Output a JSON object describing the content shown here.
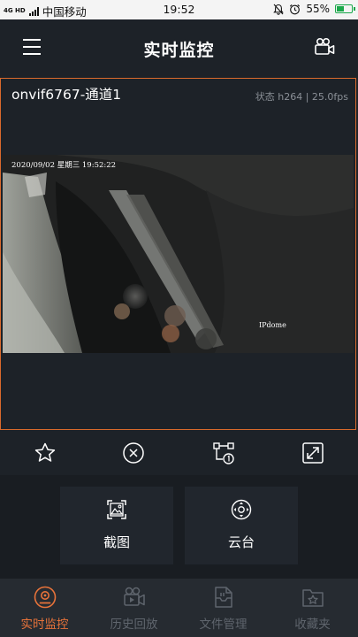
{
  "status_bar": {
    "network": "4G HD",
    "carrier": "中国移动",
    "time": "19:52",
    "battery_percent": "55%",
    "battery_level": 0.55
  },
  "header": {
    "title": "实时监控",
    "menu_icon": "hamburger-menu-icon",
    "camera_icon": "video-camera-icon"
  },
  "video": {
    "channel_name": "onvif6767-通道1",
    "stream_info": "状态 h264 | 25.0fps",
    "osd_timestamp": "2020/09/02 星期三 19:52:22",
    "osd_brand": "IPdome"
  },
  "actions": [
    {
      "icon": "star-icon"
    },
    {
      "icon": "close-circle-icon"
    },
    {
      "icon": "stream-switch-icon"
    },
    {
      "icon": "fullscreen-icon"
    }
  ],
  "tools": [
    {
      "label": "截图",
      "icon": "screenshot-image-icon"
    },
    {
      "label": "云台",
      "icon": "ptz-control-icon"
    }
  ],
  "tabs": [
    {
      "label": "实时监控",
      "icon": "live-monitor-icon",
      "active": true
    },
    {
      "label": "历史回放",
      "icon": "playback-icon",
      "active": false
    },
    {
      "label": "文件管理",
      "icon": "file-manager-icon",
      "active": false
    },
    {
      "label": "收藏夹",
      "icon": "favorites-icon",
      "active": false
    }
  ],
  "colors": {
    "accent": "#e8733a",
    "background": "#1d2228",
    "tab_inactive": "#5f656d"
  }
}
